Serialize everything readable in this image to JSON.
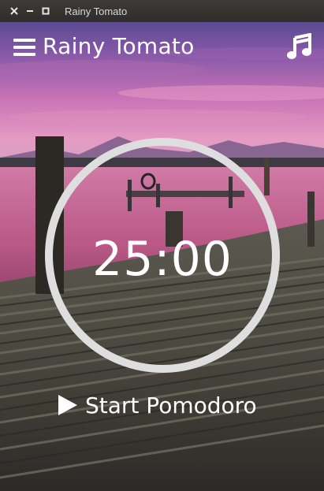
{
  "window": {
    "title": "Rainy Tomato"
  },
  "header": {
    "title": "Rainy Tomato",
    "menu_icon": "hamburger-menu-icon",
    "music_icon": "music-note-icon"
  },
  "timer": {
    "display": "25:00"
  },
  "start_button": {
    "label": "Start Pomodoro",
    "icon": "play-icon"
  },
  "colors": {
    "ring": "#dedede",
    "text": "#ffffff",
    "sky_top": "#6a4f9a",
    "sky_mid": "#d777b8",
    "water": "#c45e8c"
  }
}
